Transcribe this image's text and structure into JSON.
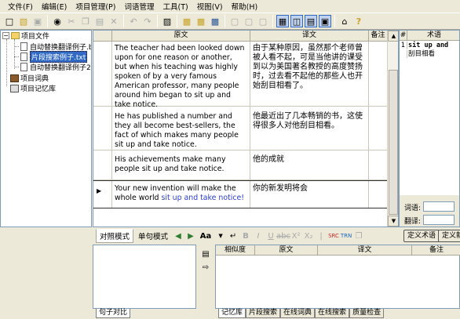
{
  "menu": [
    "文件(F)",
    "编辑(E)",
    "项目管理(P)",
    "词语管理",
    "工具(T)",
    "视图(V)",
    "帮助(H)"
  ],
  "toolbar_icons": [
    "new-icon",
    "open-icon",
    "save-icon",
    "find-icon",
    "cut-icon",
    "copy-icon",
    "paste-icon",
    "delete-icon",
    "undo-icon",
    "redo-icon",
    "print-icon",
    "export-icon",
    "import-icon",
    "word-icon",
    "copy2-icon",
    "doc-icon",
    "align-icon",
    "layout1-icon",
    "layout2-icon",
    "layout3-icon",
    "layout4-icon",
    "home-icon",
    "help-icon"
  ],
  "tree": {
    "root": "项目文件",
    "files": [
      "自动替换翻译例子.b",
      "片段搜索例子.txt",
      "自动替换翻译例子2."
    ],
    "dict": "项目词典",
    "memory": "项目记忆库"
  },
  "grid": {
    "headers": {
      "source": "原文",
      "target": "译文",
      "note": "备注"
    },
    "rows": [
      {
        "source": "The teacher had been looked down upon for one reason or another, but when his teaching was highly spoken of by a very famous American professor, many people around him began to sit up and take notice.",
        "source_hl": "",
        "target": "由于某种原因，虽然那个老师曾被人看不起，可是当他讲的课受到以为美国著名教授的高度赞扬时，过去看不起他的那些人也开始刮目相看了。"
      },
      {
        "source": "He has published a number and they all become best-sellers, the fact of which makes many people sit up and take notice.",
        "source_hl": "",
        "target": "他最近出了几本畅销的书，这使得很多人对他刮目相看。"
      },
      {
        "source": "His achievements make many people sit up and take notice.",
        "source_hl": "",
        "target": "他的成就"
      },
      {
        "source": "Your new invention will make the whole world ",
        "source_hl": "sit up and take notice!",
        "target": "你的新发明将会"
      }
    ]
  },
  "terms": {
    "headers": {
      "index": "#",
      "term": "术语"
    },
    "rows": [
      {
        "index": "1",
        "en": "sit up and",
        "zh": "刮目相看"
      }
    ],
    "label_term": "词语:",
    "label_translation": "翻译:",
    "btn_define": "定义术语",
    "btn_define_new": "定义新"
  },
  "modebar": {
    "tab_compare": "对照模式",
    "tab_single": "单句模式",
    "font_label": "Aa"
  },
  "bottom": {
    "headers": {
      "similarity": "相似度",
      "source": "原文",
      "target": "译文",
      "note": "备注"
    },
    "left_tab": "句子对比",
    "right_tabs": [
      "记忆库",
      "片段搜索",
      "在线词典",
      "在线搜索",
      "质量检查"
    ]
  }
}
